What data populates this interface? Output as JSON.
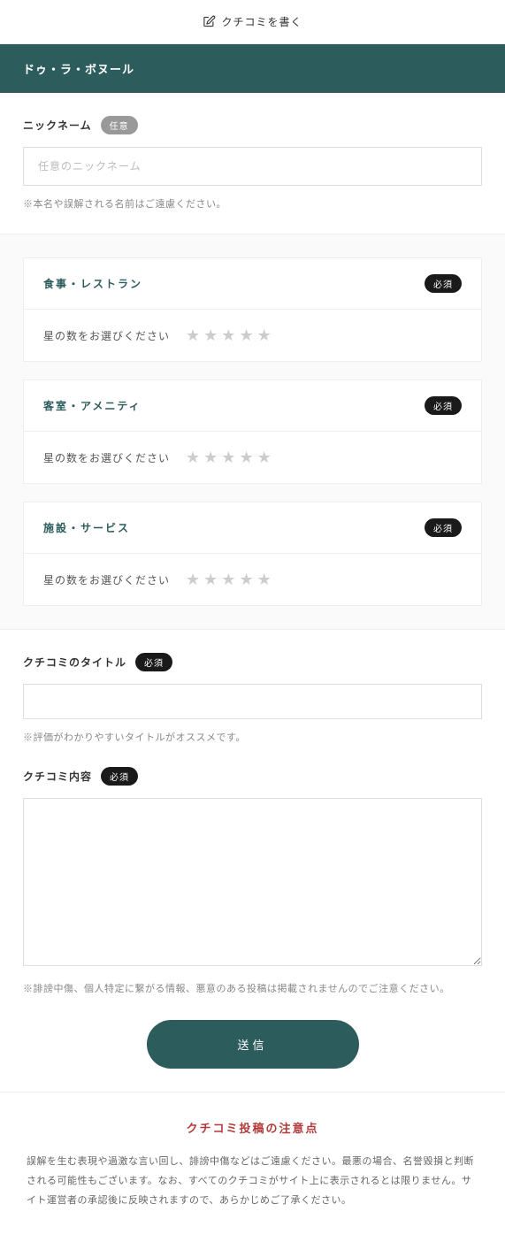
{
  "header": {
    "title": "クチコミを書く"
  },
  "property": {
    "name": "ドゥ・ラ・ボヌール"
  },
  "nickname": {
    "label": "ニックネーム",
    "badge": "任意",
    "placeholder": "任意のニックネーム",
    "hint": "※本名や誤解される名前はご遠慮ください。"
  },
  "ratings": {
    "prompt": "星の数をお選びください",
    "required_badge": "必須",
    "items": [
      {
        "title": "食事・レストラン"
      },
      {
        "title": "客室・アメニティ"
      },
      {
        "title": "施設・サービス"
      }
    ]
  },
  "title_field": {
    "label": "クチコミのタイトル",
    "badge": "必須",
    "hint": "※評価がわかりやすいタイトルがオススメです。"
  },
  "content_field": {
    "label": "クチコミ内容",
    "badge": "必須",
    "hint": "※誹謗中傷、個人特定に繋がる情報、悪意のある投稿は掲載されませんのでご注意ください。"
  },
  "submit": {
    "label": "送信"
  },
  "notice": {
    "title": "クチコミ投稿の注意点",
    "text": "誤解を生む表現や過激な言い回し、誹謗中傷などはご遠慮ください。最悪の場合、名誉毀損と判断される可能性もございます。なお、すべてのクチコミがサイト上に表示されるとは限りません。サイト運営者の承認後に反映されますので、あらかじめご了承ください。"
  }
}
